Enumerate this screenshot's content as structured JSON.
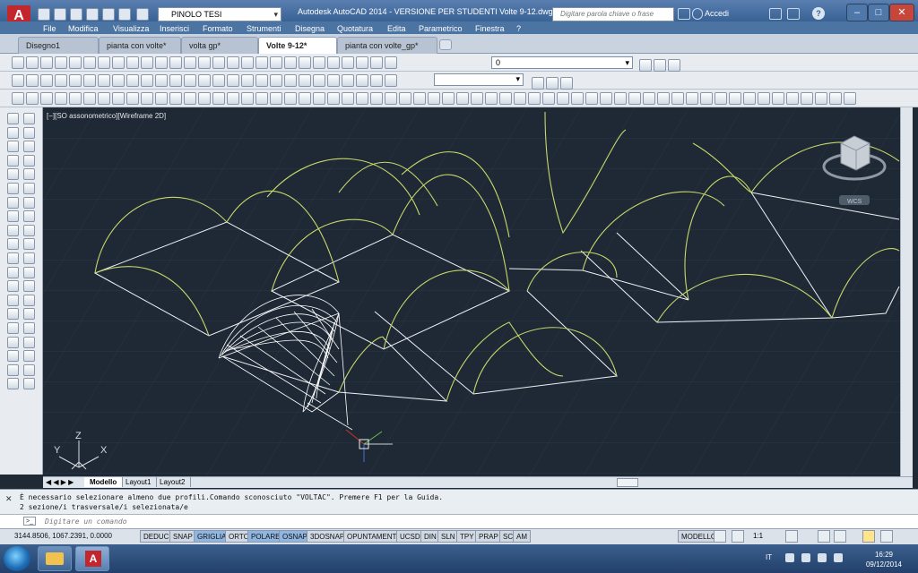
{
  "titlebar": {
    "app_letter": "A",
    "workspace": "PINOLO TESI",
    "title": "Autodesk AutoCAD 2014 - VERSIONE PER STUDENTI     Volte 9-12.dwg",
    "search_placeholder": "Digitare parola chiave o frase",
    "signin_label": "Accedi",
    "help_label": "?"
  },
  "menu": [
    "File",
    "Modifica",
    "Visualizza",
    "Inserisci",
    "Formato",
    "Strumenti",
    "Disegna",
    "Quotatura",
    "Edita",
    "Parametrico",
    "Finestra",
    "?"
  ],
  "doc_tabs": [
    "Disegno1",
    "pianta con volte*",
    "volta gp*",
    "Volte 9-12*",
    "pianta con volte_gp*"
  ],
  "active_tab": "Volte 9-12*",
  "layer_combo": "0",
  "viewport_label": "[−][SO assonometrico][Wireframe 2D]",
  "viewcube_label": "WCS",
  "ucs": {
    "x": "X",
    "y": "Y",
    "z": "Z"
  },
  "layout_tabs": [
    "Modello",
    "Layout1",
    "Layout2"
  ],
  "command": {
    "line1": "È necessario selezionare almeno due profili.Comando sconosciuto \"VOLTAC\". Premere F1 per la Guida.",
    "line2": "2 sezione/i trasversale/i selezionata/e",
    "prompt": "Digitare un comando"
  },
  "status": {
    "coords": "3144.8506, 1067.2391, 0.0000",
    "toggles": [
      "DEDUCI",
      "SNAP",
      "GRIGLIA",
      "ORTO",
      "POLARE",
      "OSNAP",
      "3DOSNAP",
      "OPUNTAMENTO",
      "UCSD",
      "DIN",
      "SLN",
      "TPY",
      "PRAP",
      "SC",
      "AM"
    ],
    "on_toggles": [
      "GRIGLIA",
      "POLARE",
      "OSNAP"
    ],
    "model": "MODELLO",
    "scale": "1:1"
  },
  "taskbar": {
    "lang": "IT",
    "time": "16:29",
    "date": "09/12/2014"
  },
  "colors": {
    "canvas_bg": "#1e2935",
    "vault_yellow": "#c8d86a",
    "wire_white": "#eef2f6"
  }
}
